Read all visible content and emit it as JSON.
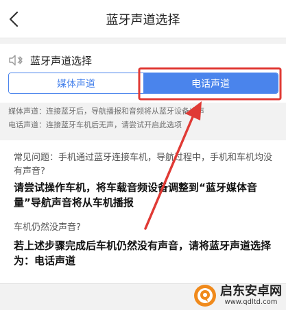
{
  "header": {
    "title": "蓝牙声道选择",
    "back_icon": "chevron-left-icon"
  },
  "channel": {
    "section_icon": "bluetooth-speaker-icon",
    "title": "蓝牙声道选择",
    "options": [
      {
        "label": "媒体声道",
        "selected": false
      },
      {
        "label": "电话声道",
        "selected": true
      }
    ]
  },
  "notes": [
    "媒体声道：连接蓝牙后，导航播报和音频将从蓝牙设备出声",
    "电话声道：连接蓝牙车机后无声，请尝试开启此选项"
  ],
  "faq": {
    "q1": "常见问题：手机通过蓝牙连接车机，导航过程中，手机和车机均没有声音?",
    "a1": "请尝试操作车机，将车载音频设备调整到“蓝牙媒体音量”导航声音将从车机播报",
    "q2": "车机仍然没声音?",
    "a2": "若上述步骤完成后车机仍然没有声音，请将蓝牙声道选择为：电话声道"
  },
  "watermark": {
    "name": "启东安卓网",
    "url": "www.qdltd.com"
  },
  "colors": {
    "accent": "#4a84ec",
    "annotation": "#e03a35"
  }
}
